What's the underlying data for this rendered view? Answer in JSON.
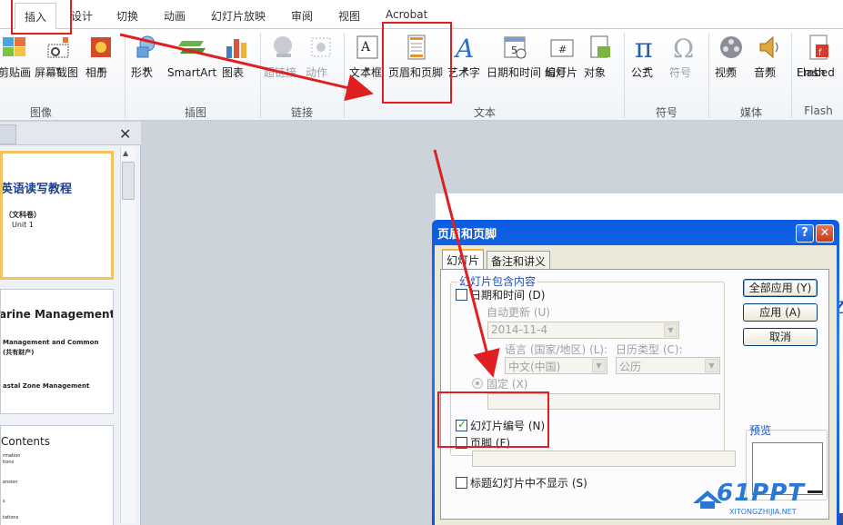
{
  "ribbon_tabs": [
    "插入",
    "设计",
    "切换",
    "动画",
    "幻灯片放映",
    "审阅",
    "视图",
    "Acrobat"
  ],
  "ribbon": {
    "buttons": {
      "paste_screen": "剪贴画",
      "screenshot": "屏幕截图",
      "album": "相册",
      "shapes": "形状",
      "smartart": "SmartArt",
      "chart": "图表",
      "hyperlink": "超链接",
      "action": "动作",
      "textbox": "文本框",
      "header_footer": "页眉和页脚",
      "wordart": "艺术字",
      "datetime": "日期和时间",
      "slide_number_l1": "幻灯片",
      "slide_number_l2": "编号",
      "object": "对象",
      "equation": "公式",
      "symbol": "符号",
      "video": "视频",
      "audio": "音频",
      "flash_l1": "Embed",
      "flash_l2": "Flash"
    },
    "groups": {
      "image": "图像",
      "illustrations": "插图",
      "links": "链接",
      "text": "文本",
      "symbols": "符号",
      "media": "媒体",
      "flash": "Flash"
    },
    "icon_names": [
      "clipart-icon",
      "screenshot-icon",
      "album-icon",
      "shapes-icon",
      "smartart-icon",
      "chart-icon",
      "hyperlink-icon",
      "action-icon",
      "textbox-icon",
      "header-footer-icon",
      "wordart-icon",
      "datetime-icon",
      "slide-number-icon",
      "object-icon",
      "equation-icon",
      "symbol-icon",
      "video-icon",
      "audio-icon",
      "flash-icon"
    ]
  },
  "slide_pane": {
    "close_glyph": "✕",
    "thumbs": [
      {
        "title": "英语读写教程",
        "line1": "（文科卷）",
        "line2": "Unit 1"
      },
      {
        "title": "arine Management",
        "line1": "Management and Common",
        "line2": "(共有财产)",
        "line3": "astal Zone Management"
      },
      {
        "title": "Contents",
        "line1": "rmation",
        "line2": "tions",
        "line3": "ension",
        "line4": "s",
        "line5": "tations"
      }
    ]
  },
  "dialog": {
    "title": "页眉和页脚",
    "help_glyph": "?",
    "close_glyph": "✕",
    "tabs": [
      "幻灯片",
      "备注和讲义"
    ],
    "group_label": "幻灯片包含内容",
    "datetime_label": "日期和时间",
    "datetime_key": "(D)",
    "auto_update_label": "自动更新",
    "auto_update_key": "(U)",
    "date_value": "2014-11-4",
    "language_label": "语言 (国家/地区)",
    "language_key": "(L):",
    "calendar_label": "日历类型",
    "calendar_key": "(C):",
    "language_value": "中文(中国)",
    "calendar_value": "公历",
    "fixed_label": "固定",
    "fixed_key": "(X)",
    "slide_number_label": "幻灯片编号",
    "slide_number_key": "(N)",
    "slide_number_checked": true,
    "footer_label": "页脚",
    "footer_key": "(F)",
    "footer_checked": false,
    "hide_title_label": "标题幻灯片中不显示",
    "hide_title_key": "(S)",
    "preview_label": "预览",
    "buttons": {
      "apply_all": "全部应用",
      "apply_all_key": "(Y)",
      "apply": "应用",
      "apply_key": "(A)",
      "cancel": "取消"
    }
  },
  "watermark": {
    "text": "61PPT",
    "subtext": "XITONGZHIJIA.NET"
  },
  "colors": {
    "annotation_red": "#e02020",
    "dialog_title_blue": "#0a5be0",
    "group_label_blue": "#1f4fbf",
    "thumb_select": "#f2c35f"
  }
}
